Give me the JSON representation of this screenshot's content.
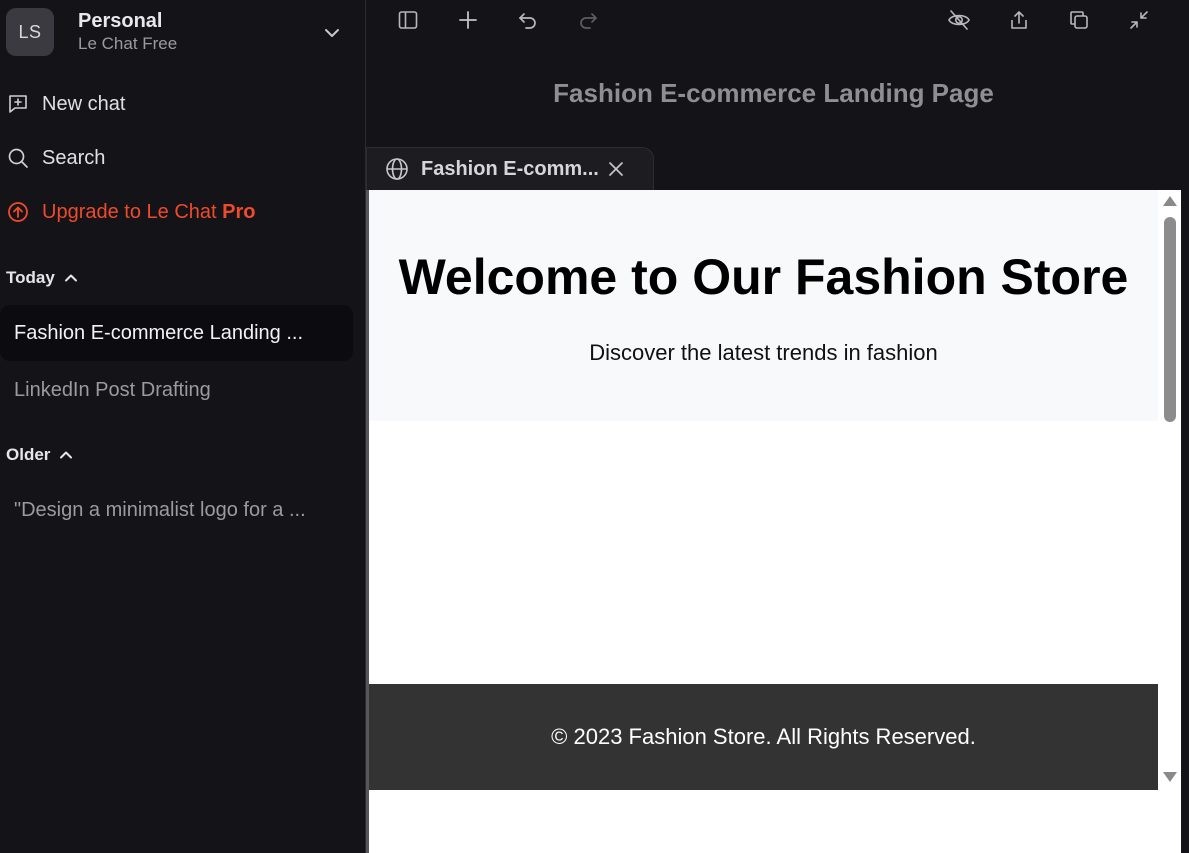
{
  "workspace": {
    "initials": "LS",
    "name": "Personal",
    "plan": "Le Chat Free"
  },
  "nav": {
    "new_chat": "New chat",
    "search": "Search",
    "upgrade_prefix": "Upgrade to Le Chat ",
    "upgrade_bold": "Pro"
  },
  "sections": {
    "today": "Today",
    "older": "Older"
  },
  "chats": {
    "today": [
      "Fashion E-commerce Landing ...",
      "LinkedIn Post Drafting"
    ],
    "older": [
      "\"Design a minimalist logo for a ..."
    ]
  },
  "document": {
    "title": "Fashion E-commerce Landing Page",
    "tab_label": "Fashion E-comm..."
  },
  "preview": {
    "hero_title": "Welcome to Our Fashion Store",
    "hero_subtitle": "Discover the latest trends in fashion",
    "footer_text": "© 2023 Fashion Store. All Rights Reserved."
  },
  "colors": {
    "background": "#141418",
    "accent_upgrade": "#ef4a2c",
    "footer_bg": "#333333",
    "hero_bg": "#f8f9fa"
  },
  "icons": {
    "toolbar": [
      "sidebar-toggle-icon",
      "plus-icon",
      "undo-icon",
      "redo-icon",
      "eye-off-icon",
      "share-icon",
      "copy-icon",
      "minimize-icon"
    ]
  }
}
